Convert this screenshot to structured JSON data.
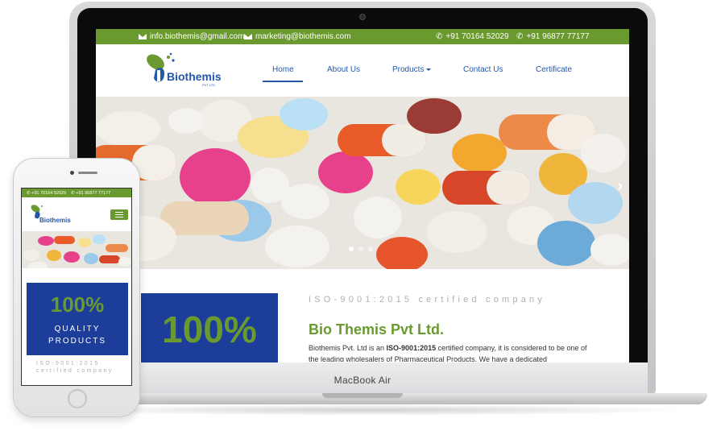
{
  "laptop": {
    "brand_label": "MacBook Air"
  },
  "site": {
    "topbar": {
      "email_1": "info.biothemis@gmail.com",
      "email_2": "marketing@biothemis.com",
      "phone_1": "+91 70164 52029",
      "phone_2": "+91 96877 77177"
    },
    "logo": {
      "name": "Biothemis",
      "suffix": "PVT LTD"
    },
    "nav": [
      {
        "label": "Home",
        "active": true
      },
      {
        "label": "About Us"
      },
      {
        "label": "Products",
        "has_dropdown": true
      },
      {
        "label": "Contact Us"
      },
      {
        "label": "Certificate"
      }
    ],
    "hero": {
      "next_arrow": "›",
      "slide_count": 3,
      "active_slide": 1
    },
    "highlight": {
      "value": "100%"
    },
    "about": {
      "iso_text": "ISO-9001:2015 certified company",
      "title": "Bio Themis Pvt Ltd.",
      "desc_prefix": "Biothemis Pvt. Ltd is an ",
      "desc_bold": "ISO-9001:2015",
      "desc_suffix": " certified company, it is considered to be one of the leading wholesalers of Pharmaceutical Products. We have a dedicated"
    }
  },
  "mobile": {
    "topbar": {
      "phone_1": "+91 70164 52029",
      "phone_2": "+91 96877 77177"
    },
    "logo": {
      "name": "Biothemis"
    },
    "box": {
      "value": "100%",
      "line1": "QUALITY",
      "line2": "PRODUCTS"
    },
    "iso_text": "ISO-9001:2015 certified company"
  },
  "colors": {
    "brand_green": "#6a9a2f",
    "brand_blue": "#2457a8",
    "box_blue": "#1c3e9a"
  },
  "icons": [
    "envelope-icon",
    "phone-icon",
    "caret-down-icon",
    "chevron-right-icon",
    "hamburger-icon"
  ]
}
